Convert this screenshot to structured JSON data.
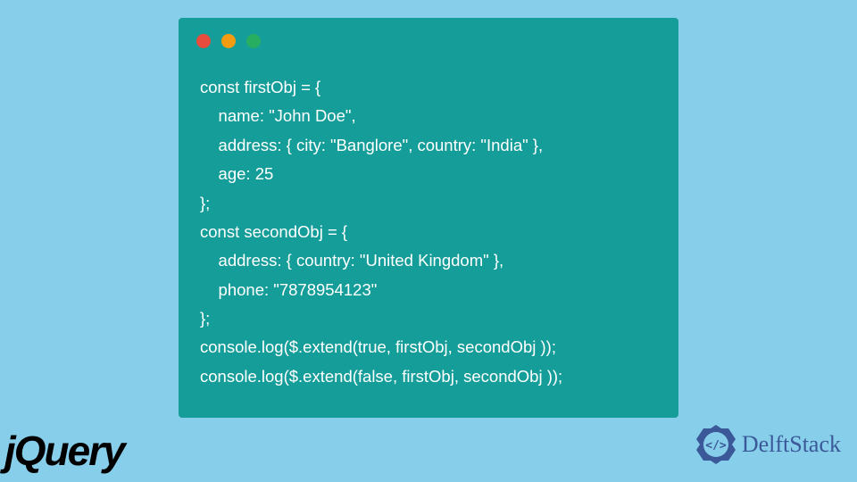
{
  "code": {
    "lines": [
      "const firstObj = {",
      "    name: \"John Doe\",",
      "    address: { city: \"Banglore\", country: \"India\" },",
      "    age: 25",
      "};",
      "const secondObj = {",
      "    address: { country: \"United Kingdom\" },",
      "    phone: \"7878954123\"",
      "};",
      "console.log($.extend(true, firstObj, secondObj ));",
      "console.log($.extend(false, firstObj, secondObj ));"
    ]
  },
  "logos": {
    "jquery": "jQuery",
    "delftstack": "DelftStack"
  },
  "colors": {
    "background": "#87ceeb",
    "codeWindow": "#159d9a",
    "dotRed": "#e74c3c",
    "dotYellow": "#f39c12",
    "dotGreen": "#27ae60",
    "delftstackBlue": "#3b5998"
  }
}
